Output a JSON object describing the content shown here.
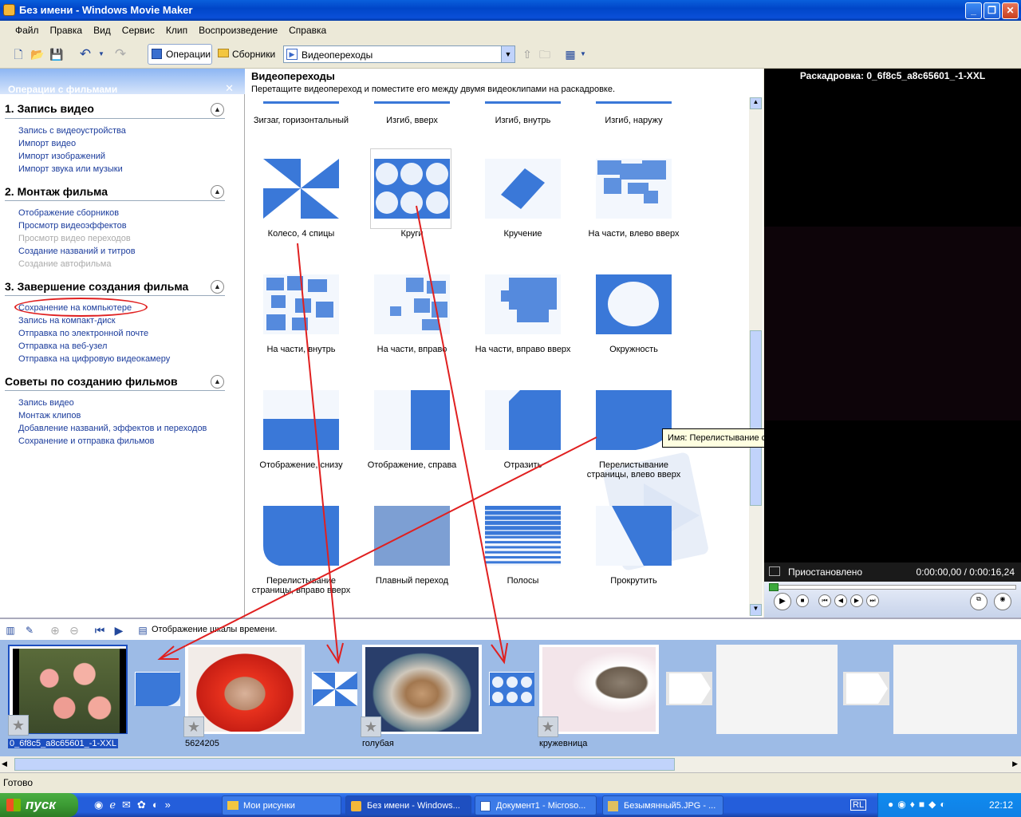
{
  "window": {
    "title": "Без имени - Windows Movie Maker"
  },
  "menu": [
    "Файл",
    "Правка",
    "Вид",
    "Сервис",
    "Клип",
    "Воспроизведение",
    "Справка"
  ],
  "toolbar": {
    "operations": "Операции",
    "collections": "Сборники",
    "combo_value": "Видеопереходы"
  },
  "tasks": {
    "header": "Операции с фильмами",
    "sections": [
      {
        "title": "1. Запись видео",
        "links": [
          "Запись с видеоустройства",
          "Импорт видео",
          "Импорт изображений",
          "Импорт звука или музыки"
        ]
      },
      {
        "title": "2. Монтаж фильма",
        "links": [
          "Отображение сборников",
          "Просмотр видеоэффектов",
          "Просмотр видео переходов",
          "Создание названий и титров",
          "Создание автофильма"
        ]
      },
      {
        "title": "3. Завершение создания фильма",
        "links": [
          "Сохранение на компьютере",
          "Запись на компакт-диск",
          "Отправка по электронной почте",
          "Отправка на веб-узел",
          "Отправка на цифровую видеокамеру"
        ]
      },
      {
        "title": "Советы по созданию фильмов",
        "links": [
          "Запись видео",
          "Монтаж клипов",
          "Добавление названий, эффектов и переходов",
          "Сохранение и отправка фильмов"
        ]
      }
    ]
  },
  "transitions": {
    "title": "Видеопереходы",
    "subtitle": "Перетащите видеопереход и поместите его между двумя видеоклипами на раскадровке.",
    "items": [
      "Зигзаг, горизонтальный",
      "Изгиб, вверх",
      "Изгиб, внутрь",
      "Изгиб, наружу",
      "Колесо, 4 спицы",
      "Круги",
      "Кручение",
      "На части, влево вверх",
      "На части, внутрь",
      "На части, вправо",
      "На части, вправо вверх",
      "Окружность",
      "Отображение, снизу",
      "Отображение, справа",
      "Отразить",
      "Перелистывание страницы, влево вверх",
      "Перелистывание страницы, вправо вверх",
      "Плавный переход",
      "Полосы",
      "Прокрутить"
    ]
  },
  "tooltip": "Имя: Перелистывание страницы, влево вверх",
  "preview": {
    "title": "Раскадровка: 0_6f8c5_a8c65601_-1-XXL",
    "status": "Приостановлено",
    "time": "0:00:00,00 / 0:00:16,24"
  },
  "storyboard": {
    "toggle_label": "Отображение шкалы времени.",
    "clips": [
      "0_6f8c5_a8c65601_-1-XXL",
      "5624205",
      "голубая",
      "кружевница"
    ]
  },
  "statusbar": "Готово",
  "taskbar": {
    "start": "пуск",
    "tasks": [
      "Мои рисунки",
      "Без имени - Windows...",
      "Документ1 - Microso...",
      "Безымянный5.JPG - ..."
    ],
    "lang": "RL",
    "clock": "22:12"
  },
  "colors": {
    "accent": "#0a5fdc",
    "annotation": "#e02020",
    "transition_blue": "#3a78d8"
  }
}
